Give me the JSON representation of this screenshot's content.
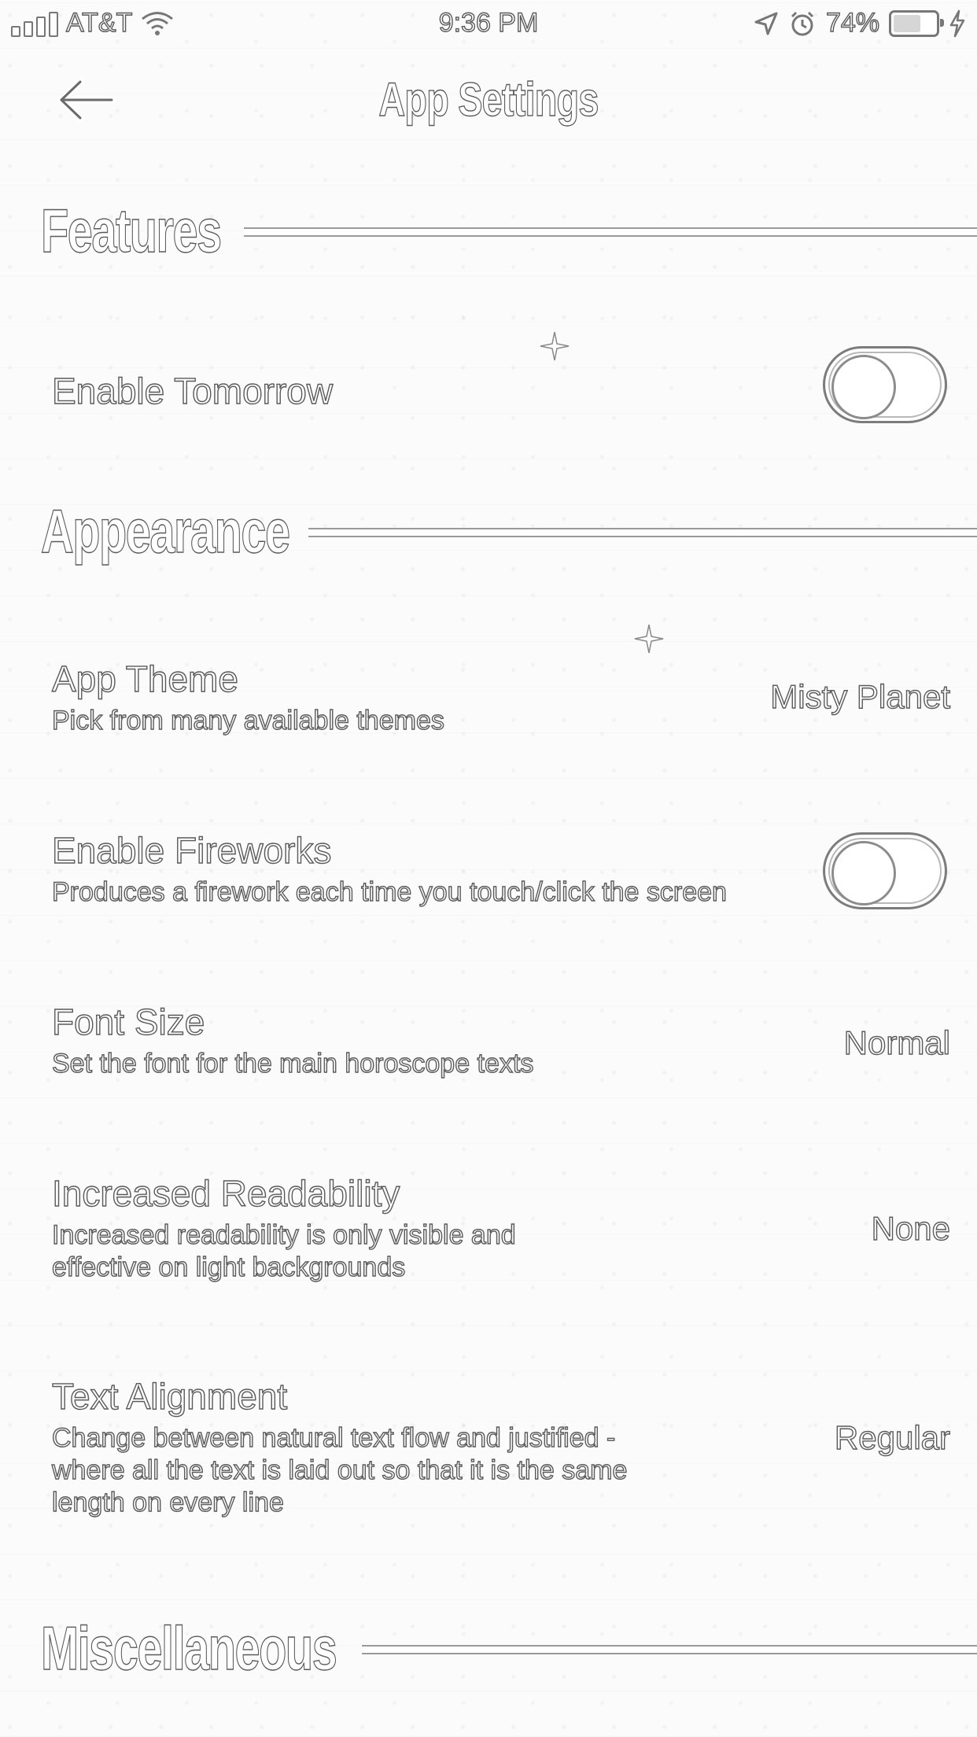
{
  "status_bar": {
    "carrier": "AT&T",
    "time": "9:36 PM",
    "battery_percent": "74%",
    "battery_level": 0.74
  },
  "header": {
    "title": "App Settings"
  },
  "sections": {
    "features": {
      "title": "Features",
      "enable_tomorrow": {
        "label": "Enable Tomorrow",
        "enabled": false
      }
    },
    "appearance": {
      "title": "Appearance",
      "app_theme": {
        "label": "App Theme",
        "description": "Pick from many available themes",
        "value": "Misty Planet"
      },
      "enable_fireworks": {
        "label": "Enable Fireworks",
        "description": "Produces a firework each time you touch/click the screen",
        "enabled": false
      },
      "font_size": {
        "label": "Font Size",
        "description": "Set the font for the main horoscope texts",
        "value": "Normal"
      },
      "increased_readability": {
        "label": "Increased Readability",
        "description": "Increased readability is only visible and effective on light backgrounds",
        "value": "None"
      },
      "text_alignment": {
        "label": "Text Alignment",
        "description": "Change between natural text flow and justified - where all the text is laid out so that it is the same length on every line",
        "value": "Regular"
      }
    },
    "miscellaneous": {
      "title": "Miscellaneous"
    }
  },
  "icons": {
    "back": "back-arrow-icon",
    "wifi": "wifi-icon",
    "location": "location-arrow-icon",
    "alarm": "alarm-icon",
    "battery": "battery-icon",
    "charging": "charging-bolt-icon",
    "signal": "signal-bars-icon",
    "sparkle": "sparkle-icon"
  }
}
